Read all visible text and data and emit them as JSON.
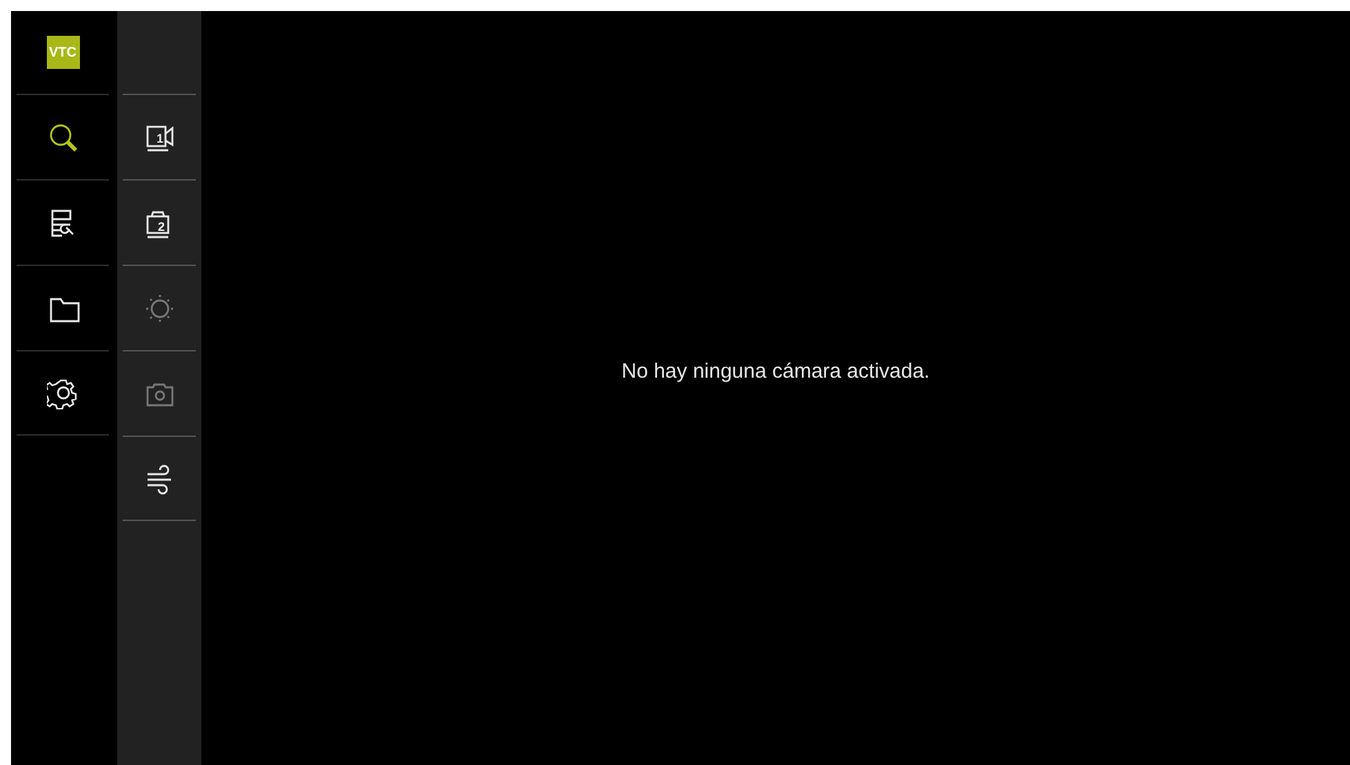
{
  "logo": {
    "text": "VTC"
  },
  "nav": [
    {
      "kind": "search",
      "selected": true
    },
    {
      "kind": "inspect",
      "selected": false
    },
    {
      "kind": "folder",
      "selected": false
    },
    {
      "kind": "settings",
      "selected": false
    }
  ],
  "tools": [
    {
      "kind": "camera",
      "label": "1",
      "disabled": false
    },
    {
      "kind": "camera-top",
      "label": "2",
      "disabled": false
    },
    {
      "kind": "light",
      "disabled": true
    },
    {
      "kind": "snapshot",
      "disabled": true
    },
    {
      "kind": "air",
      "disabled": false
    }
  ],
  "message": "No hay ninguna cámara activada."
}
